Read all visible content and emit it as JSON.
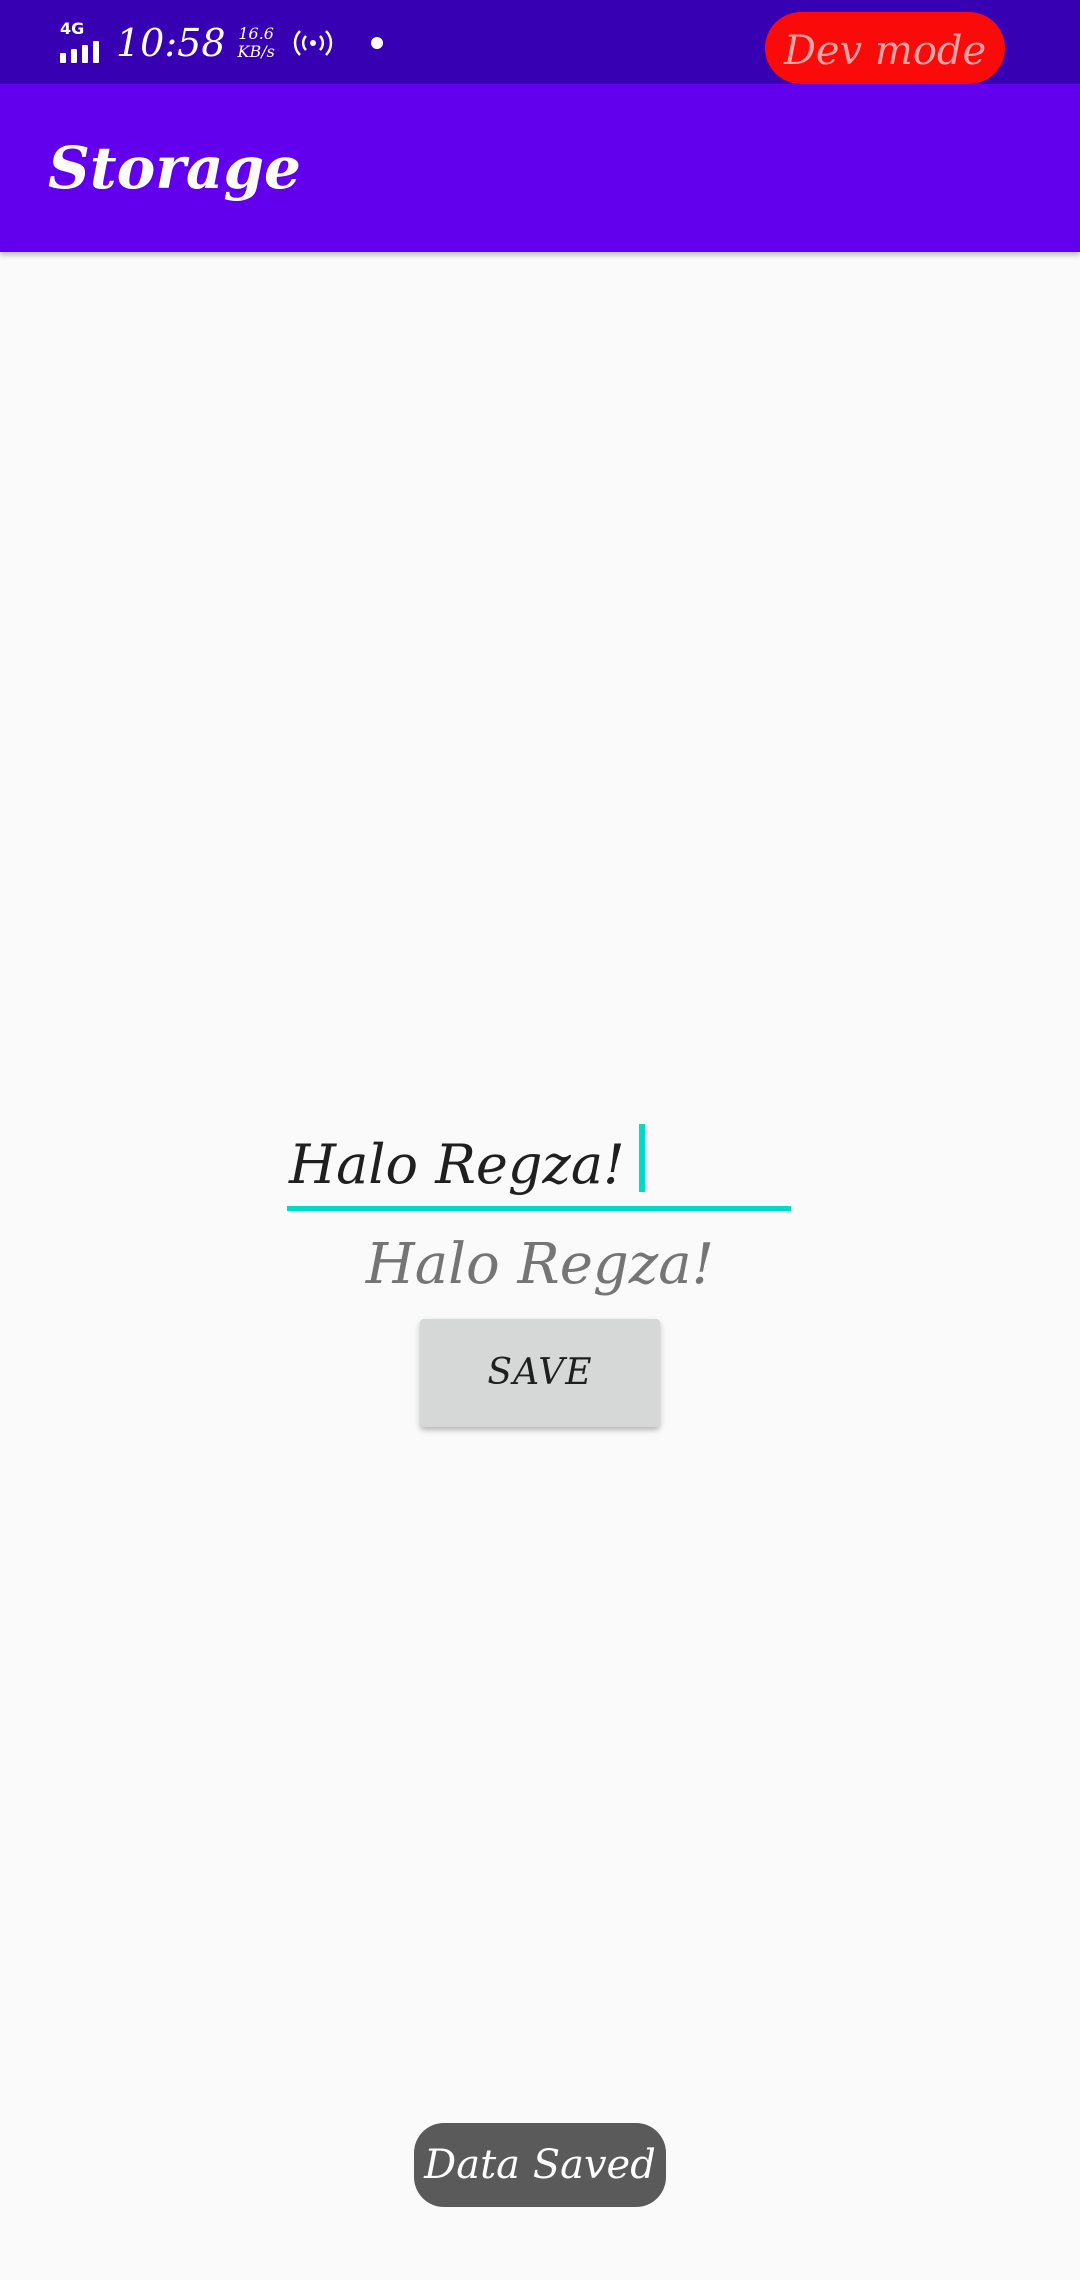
{
  "status_bar": {
    "network_type": "4G",
    "time": "10:58",
    "net_speed_value": "16.6",
    "net_speed_unit": "KB/s",
    "hotspot_icon": "hotspot-icon",
    "dev_mode_label": "Dev mode",
    "dev_mode_color": "#fb0a0a"
  },
  "app_bar": {
    "title": "Storage",
    "color": "#6200ee"
  },
  "main": {
    "input_value": "Halo Regza!",
    "output_text": "Halo Regza!",
    "save_label": "SAVE",
    "accent_color": "#03dac5"
  },
  "toast": {
    "message": "Data Saved"
  }
}
